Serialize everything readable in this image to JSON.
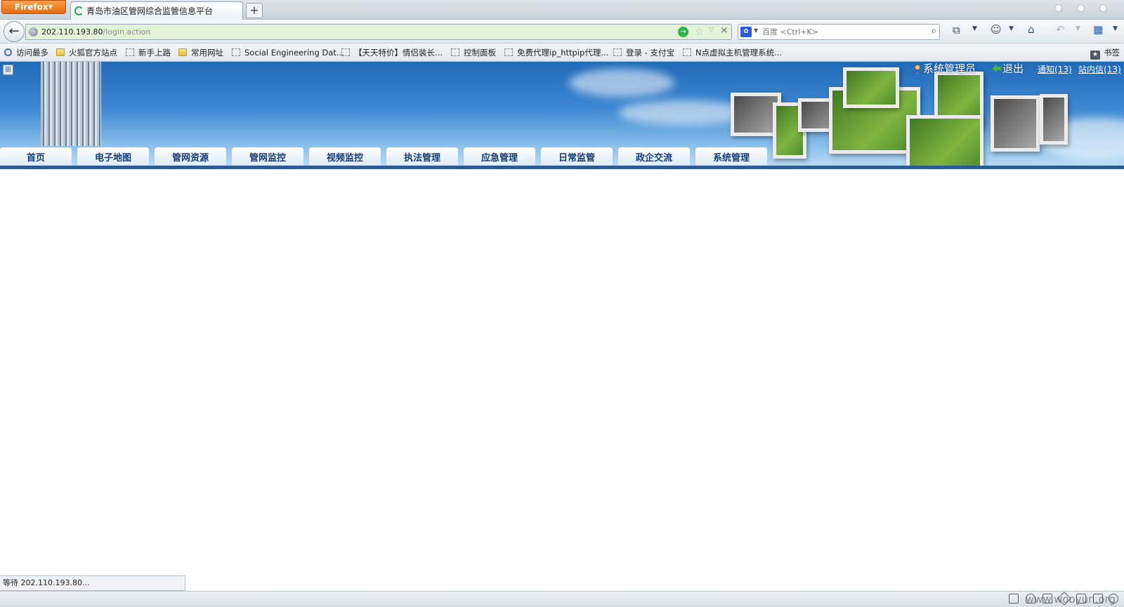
{
  "browser": {
    "app_menu_label": "Firefox",
    "tab_title": "青岛市油区管网综合监管信息平台",
    "new_tab_label": "+",
    "url_host": "202.110.193.80",
    "url_path": "/login.action",
    "search_placeholder": "百度 <Ctrl+K>"
  },
  "bookmarks": {
    "items": [
      {
        "label": "访问最多",
        "icon": "magnifier-icon"
      },
      {
        "label": "火狐官方站点",
        "icon": "folder-icon"
      },
      {
        "label": "新手上路",
        "icon": "page-icon"
      },
      {
        "label": "常用网址",
        "icon": "folder-icon"
      },
      {
        "label": "Social Engineering Dat...",
        "icon": "page-icon"
      },
      {
        "label": "【天天特价】情侣装长...",
        "icon": "page-icon"
      },
      {
        "label": "控制面板",
        "icon": "page-icon"
      },
      {
        "label": "免费代理ip_httpip代理...",
        "icon": "page-icon"
      },
      {
        "label": "登录 - 支付宝",
        "icon": "page-icon"
      },
      {
        "label": "N点虚拟主机管理系统...",
        "icon": "page-icon"
      }
    ],
    "library_label": "书签"
  },
  "header": {
    "admin_name": "系统管理员",
    "logout_label": "退出",
    "notice_link": "通知(13)",
    "message_link": "站内信(13)"
  },
  "menu": {
    "tabs": [
      "首页",
      "电子地图",
      "管网资源",
      "管网监控",
      "视频监控",
      "执法管理",
      "应急管理",
      "日常监管",
      "政企交流",
      "系统管理"
    ]
  },
  "status": {
    "text": "等待 202.110.193.80..."
  },
  "watermark": "www.wooyun.org",
  "colors": {
    "menu_text": "#123d78",
    "menu_line": "#2c5a94",
    "url_bar_bg": "#e3f3d8",
    "firefox_orange": "#e56a12"
  }
}
